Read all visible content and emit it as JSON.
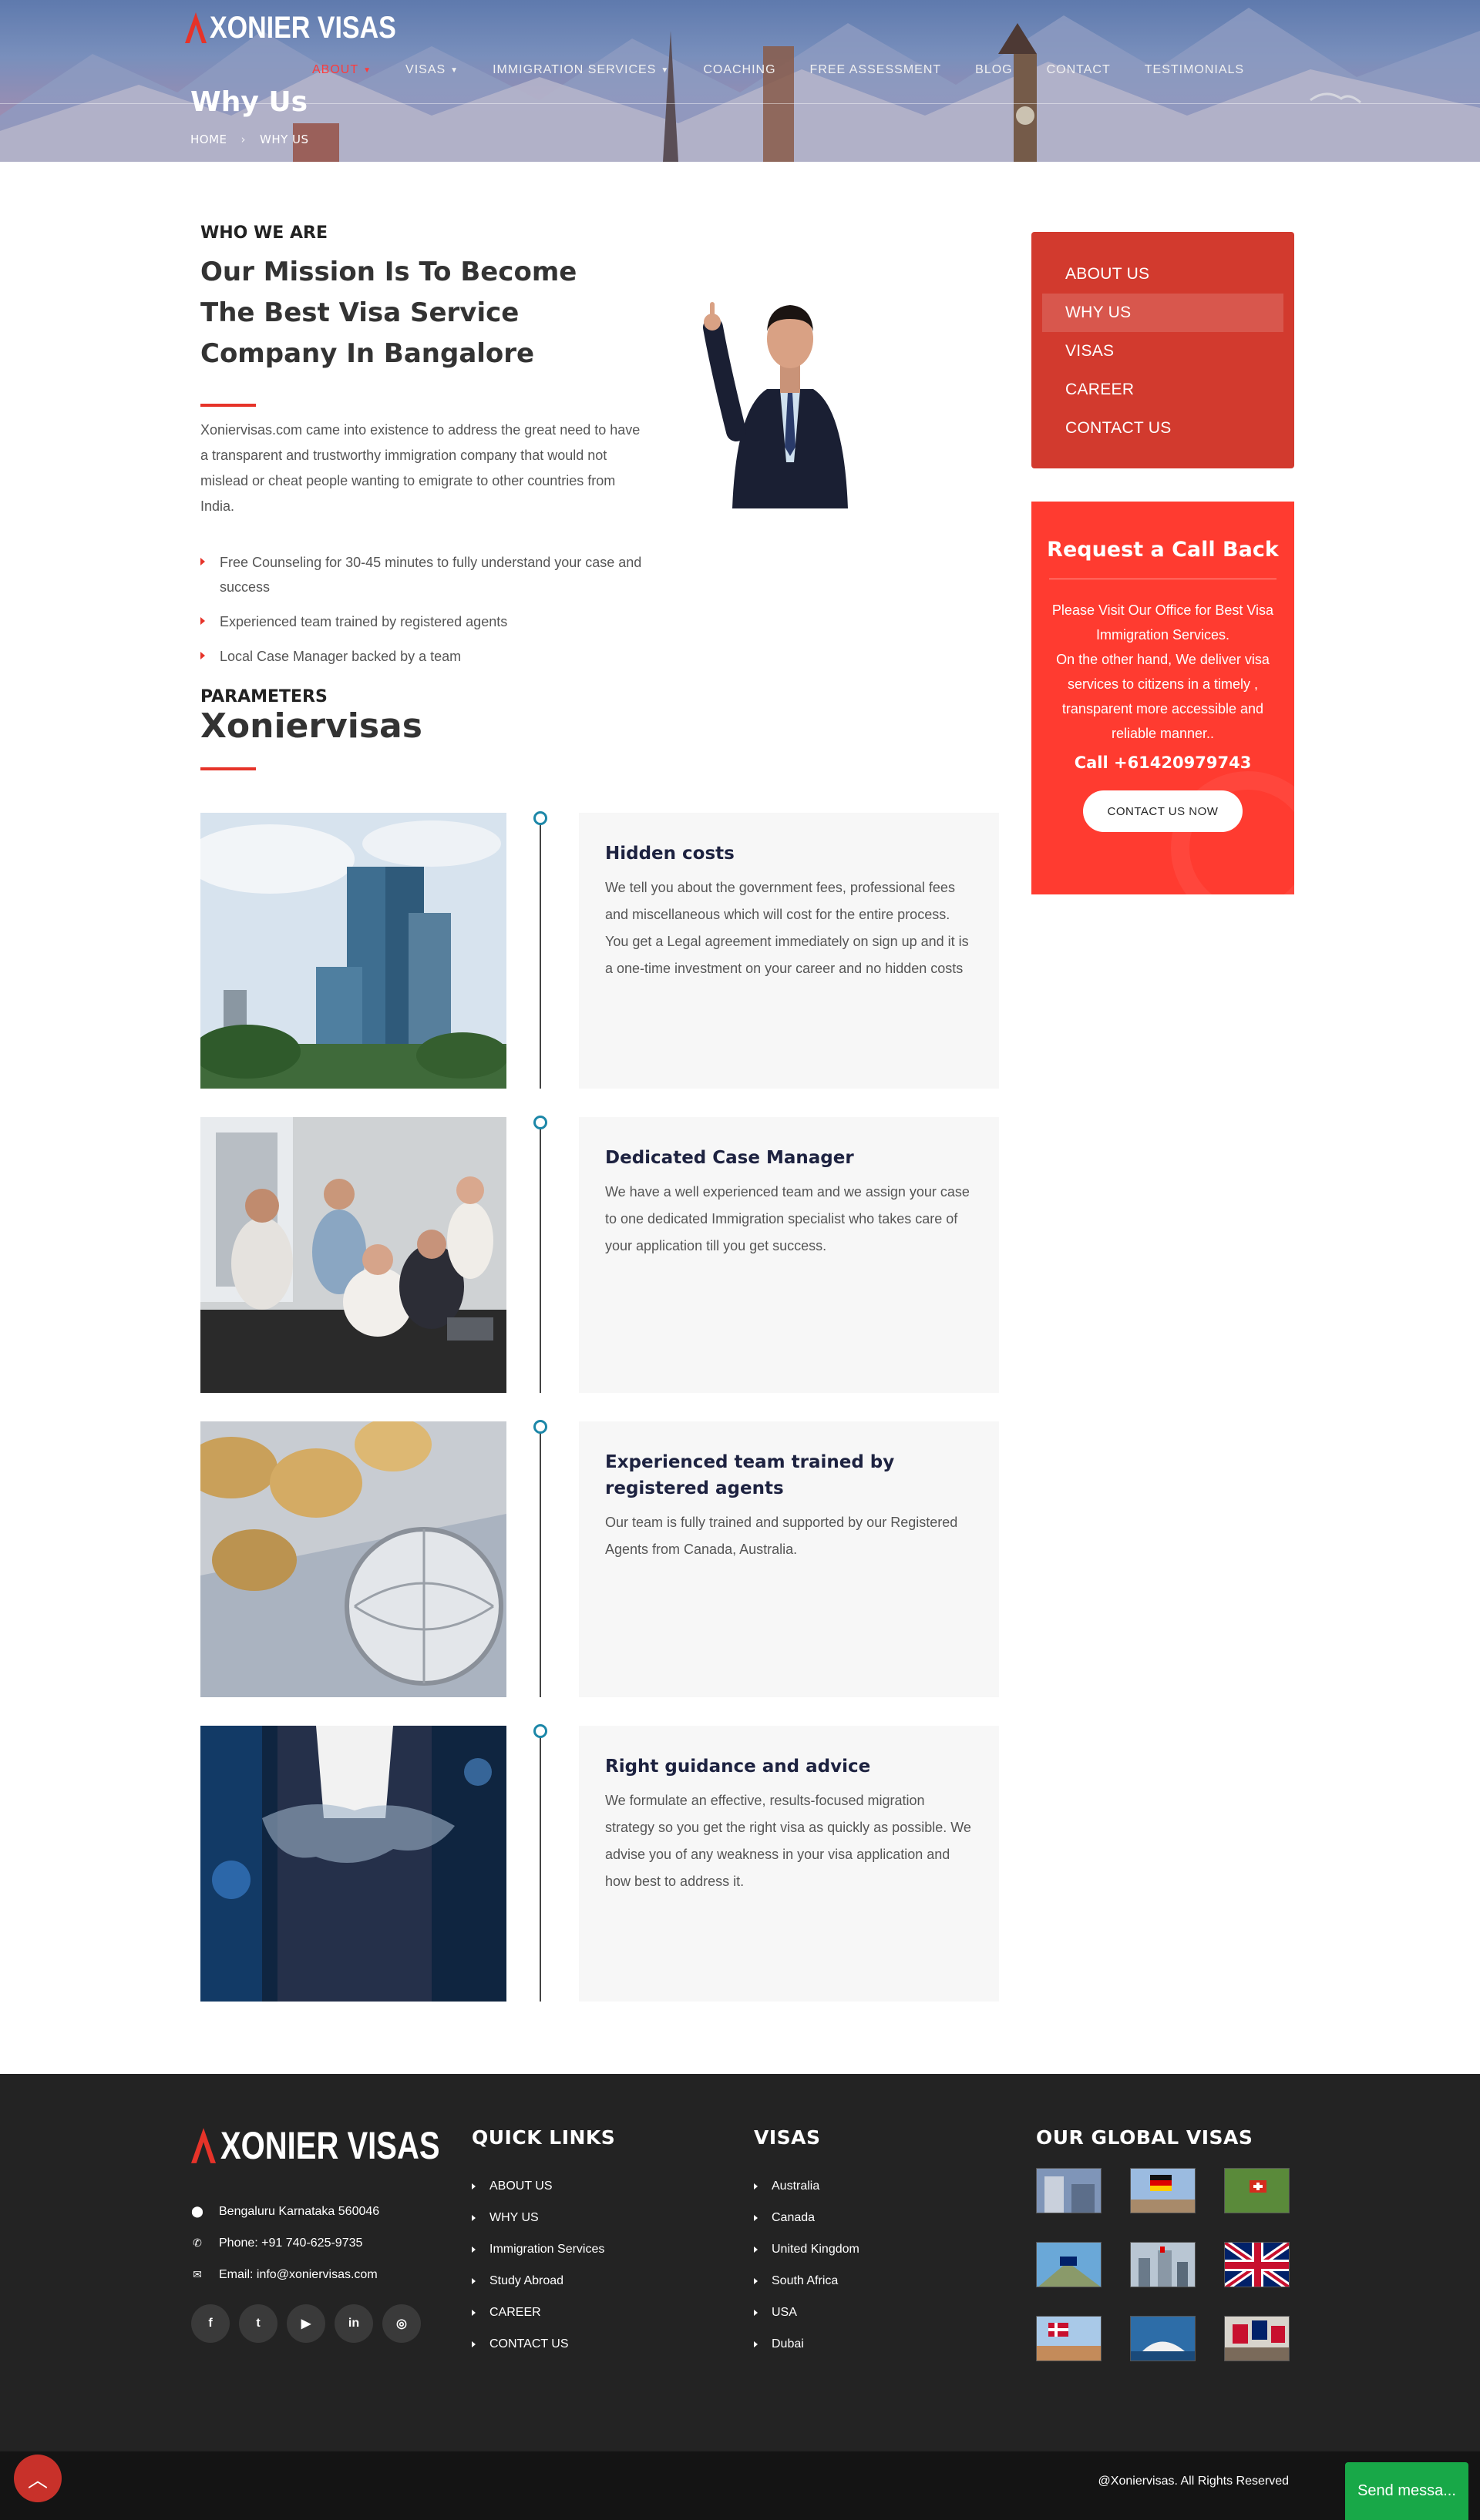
{
  "brand": {
    "name": "XONIER VISAS"
  },
  "nav": {
    "items": [
      {
        "label": "ABOUT",
        "active": true,
        "dropdown": true
      },
      {
        "label": "VISAS",
        "active": false,
        "dropdown": true
      },
      {
        "label": "IMMIGRATION SERVICES",
        "active": false,
        "dropdown": true
      },
      {
        "label": "COACHING",
        "active": false,
        "dropdown": false
      },
      {
        "label": "FREE ASSESSMENT",
        "active": false,
        "dropdown": false
      },
      {
        "label": "BLOG",
        "active": false,
        "dropdown": false
      },
      {
        "label": "CONTACT",
        "active": false,
        "dropdown": false
      },
      {
        "label": "TESTIMONIALS",
        "active": false,
        "dropdown": false
      }
    ]
  },
  "hero": {
    "title": "Why Us",
    "breadcrumb": [
      "HOME",
      "WHY US"
    ]
  },
  "intro": {
    "eyebrow": "WHO WE ARE",
    "heading": "Our Mission Is To Become The Best Visa Service Company In Bangalore",
    "text": "Xoniervisas.com came into existence to address the great need to have a transparent and trustworthy immigration company that would not mislead or cheat people wanting to emigrate to other countries from India.",
    "bullets": [
      "Free Counseling for 30-45 minutes to fully understand your case and success",
      "Experienced team trained by registered agents",
      "Local Case Manager backed by a team"
    ]
  },
  "parameters": {
    "eyebrow": "PARAMETERS",
    "title": "Xoniervisas",
    "items": [
      {
        "title": "Hidden costs",
        "text": "We tell you about the government fees, professional fees and miscellaneous which will cost for the entire process.\nYou get a Legal agreement immediately on sign up and it is a one-time investment on your career and no hidden costs"
      },
      {
        "title": "Dedicated Case Manager",
        "text": "We have a well experienced team and we assign your case to one dedicated Immigration specialist who takes care of your application till you get success."
      },
      {
        "title": "Experienced team trained by registered agents",
        "text": "Our team is fully trained and supported by our Registered Agents from Canada, Australia."
      },
      {
        "title": "Right guidance and advice",
        "text": "We formulate an effective, results-focused migration strategy so you get the right visa as quickly as possible. We advise you of any weakness in your visa application and how best to address it."
      }
    ]
  },
  "sidebar": {
    "menu": [
      {
        "label": "ABOUT US",
        "active": false
      },
      {
        "label": "WHY US",
        "active": true
      },
      {
        "label": "VISAS",
        "active": false
      },
      {
        "label": "CAREER",
        "active": false
      },
      {
        "label": "CONTACT US",
        "active": false
      }
    ],
    "callback": {
      "title": "Request a Call Back",
      "text": "Please Visit Our Office for Best Visa Immigration Services.\nOn the other hand, We deliver visa services to citizens in a timely , transparent more accessible and reliable manner..",
      "phone": "Call +61420979743",
      "button": "CONTACT US NOW"
    }
  },
  "footer": {
    "contact": [
      {
        "icon": "location-pin-icon",
        "text": "Bengaluru Karnataka 560046"
      },
      {
        "icon": "phone-icon",
        "text": "Phone: +91 740-625-9735"
      },
      {
        "icon": "envelope-icon",
        "text": "Email: info@xoniervisas.com"
      }
    ],
    "socials": [
      {
        "icon": "facebook-icon",
        "glyph": "f"
      },
      {
        "icon": "twitter-icon",
        "glyph": "t"
      },
      {
        "icon": "youtube-icon",
        "glyph": "▶"
      },
      {
        "icon": "linkedin-icon",
        "glyph": "in"
      },
      {
        "icon": "instagram-icon",
        "glyph": "◎"
      }
    ],
    "quick_links": {
      "title": "QUICK LINKS",
      "items": [
        "ABOUT US",
        "WHY US",
        "Immigration Services",
        "Study Abroad",
        "CAREER",
        "CONTACT US"
      ]
    },
    "visas": {
      "title": "VISAS",
      "items": [
        "Australia",
        "Canada",
        "United Kingdom",
        "South Africa",
        "USA",
        "Dubai"
      ]
    },
    "global": {
      "title": "OUR GLOBAL VISAS"
    },
    "copyright": "@Xoniervisas. All Rights Reserved",
    "send_message": "Send messa..."
  },
  "colors": {
    "accent": "#e63329",
    "sidebar_menu": "#d23a2e",
    "callback_bg": "#ff3b30",
    "footer_bg": "#232323",
    "timeline_dot": "#1c87a8",
    "chat_button": "#18a848"
  }
}
